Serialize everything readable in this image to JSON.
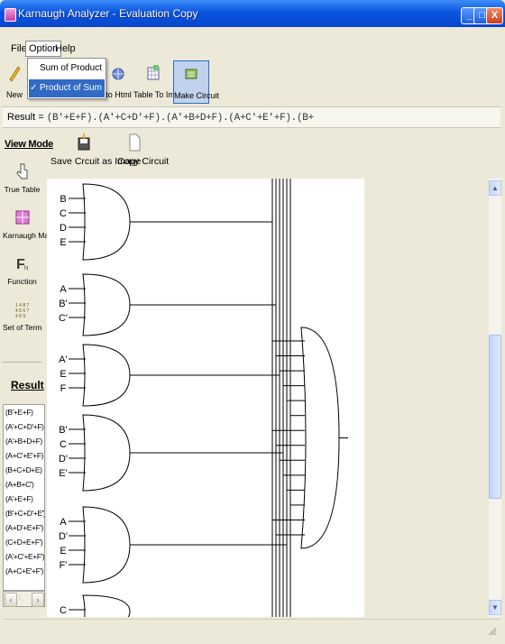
{
  "window": {
    "title": "Karnaugh Analyzer - Evaluation Copy"
  },
  "menubar": {
    "file": "File",
    "option": "Option",
    "help": "Help"
  },
  "option_menu": {
    "items": [
      "Sum of Product",
      "Product of Sum"
    ],
    "checked": "Product of Sum"
  },
  "toolbar": {
    "new": "New",
    "to_html": "t to Html",
    "table_to_image": "Table To Image",
    "make_circuit": "Make Circuit"
  },
  "result_bar": {
    "label": "Result =",
    "value": "(B'+E+F).(A'+C+D'+F).(A'+B+D+F).(A+C'+E'+F).(B+"
  },
  "view_mode": {
    "title": "View Mode",
    "items": [
      "True Table",
      "Karnaugh Map",
      "Function",
      "Set of Term"
    ]
  },
  "result_panel": {
    "title": "Result",
    "lines": [
      "(B'+E+F)",
      "(A'+C+D'+F)",
      "(A'+B+D+F)",
      "(A+C'+E'+F)",
      "(B+C+D+E)",
      "(A+B+C')",
      "(A'+E+F)",
      "(B'+C+D'+E')",
      "(A+D'+E+F')",
      "(C+D+E+F')",
      "(A'+C'+E+F')",
      "(A+C+E'+F')"
    ]
  },
  "circuit_toolbar": {
    "save": "Save Crcuit as Image",
    "copy": "Copy Circuit"
  },
  "circuit": {
    "gate_inputs": [
      [
        "B",
        "C",
        "D",
        "E"
      ],
      [
        "A",
        "B'",
        "C'"
      ],
      [
        "A'",
        "E",
        "F"
      ],
      [
        "B'",
        "C",
        "D'",
        "E'"
      ],
      [
        "A",
        "D'",
        "E",
        "F'"
      ],
      [
        "C"
      ]
    ]
  },
  "colors": {
    "titlebar": "#0a55e0",
    "selection": "#316ac5",
    "chrome": "#ece9d8"
  }
}
